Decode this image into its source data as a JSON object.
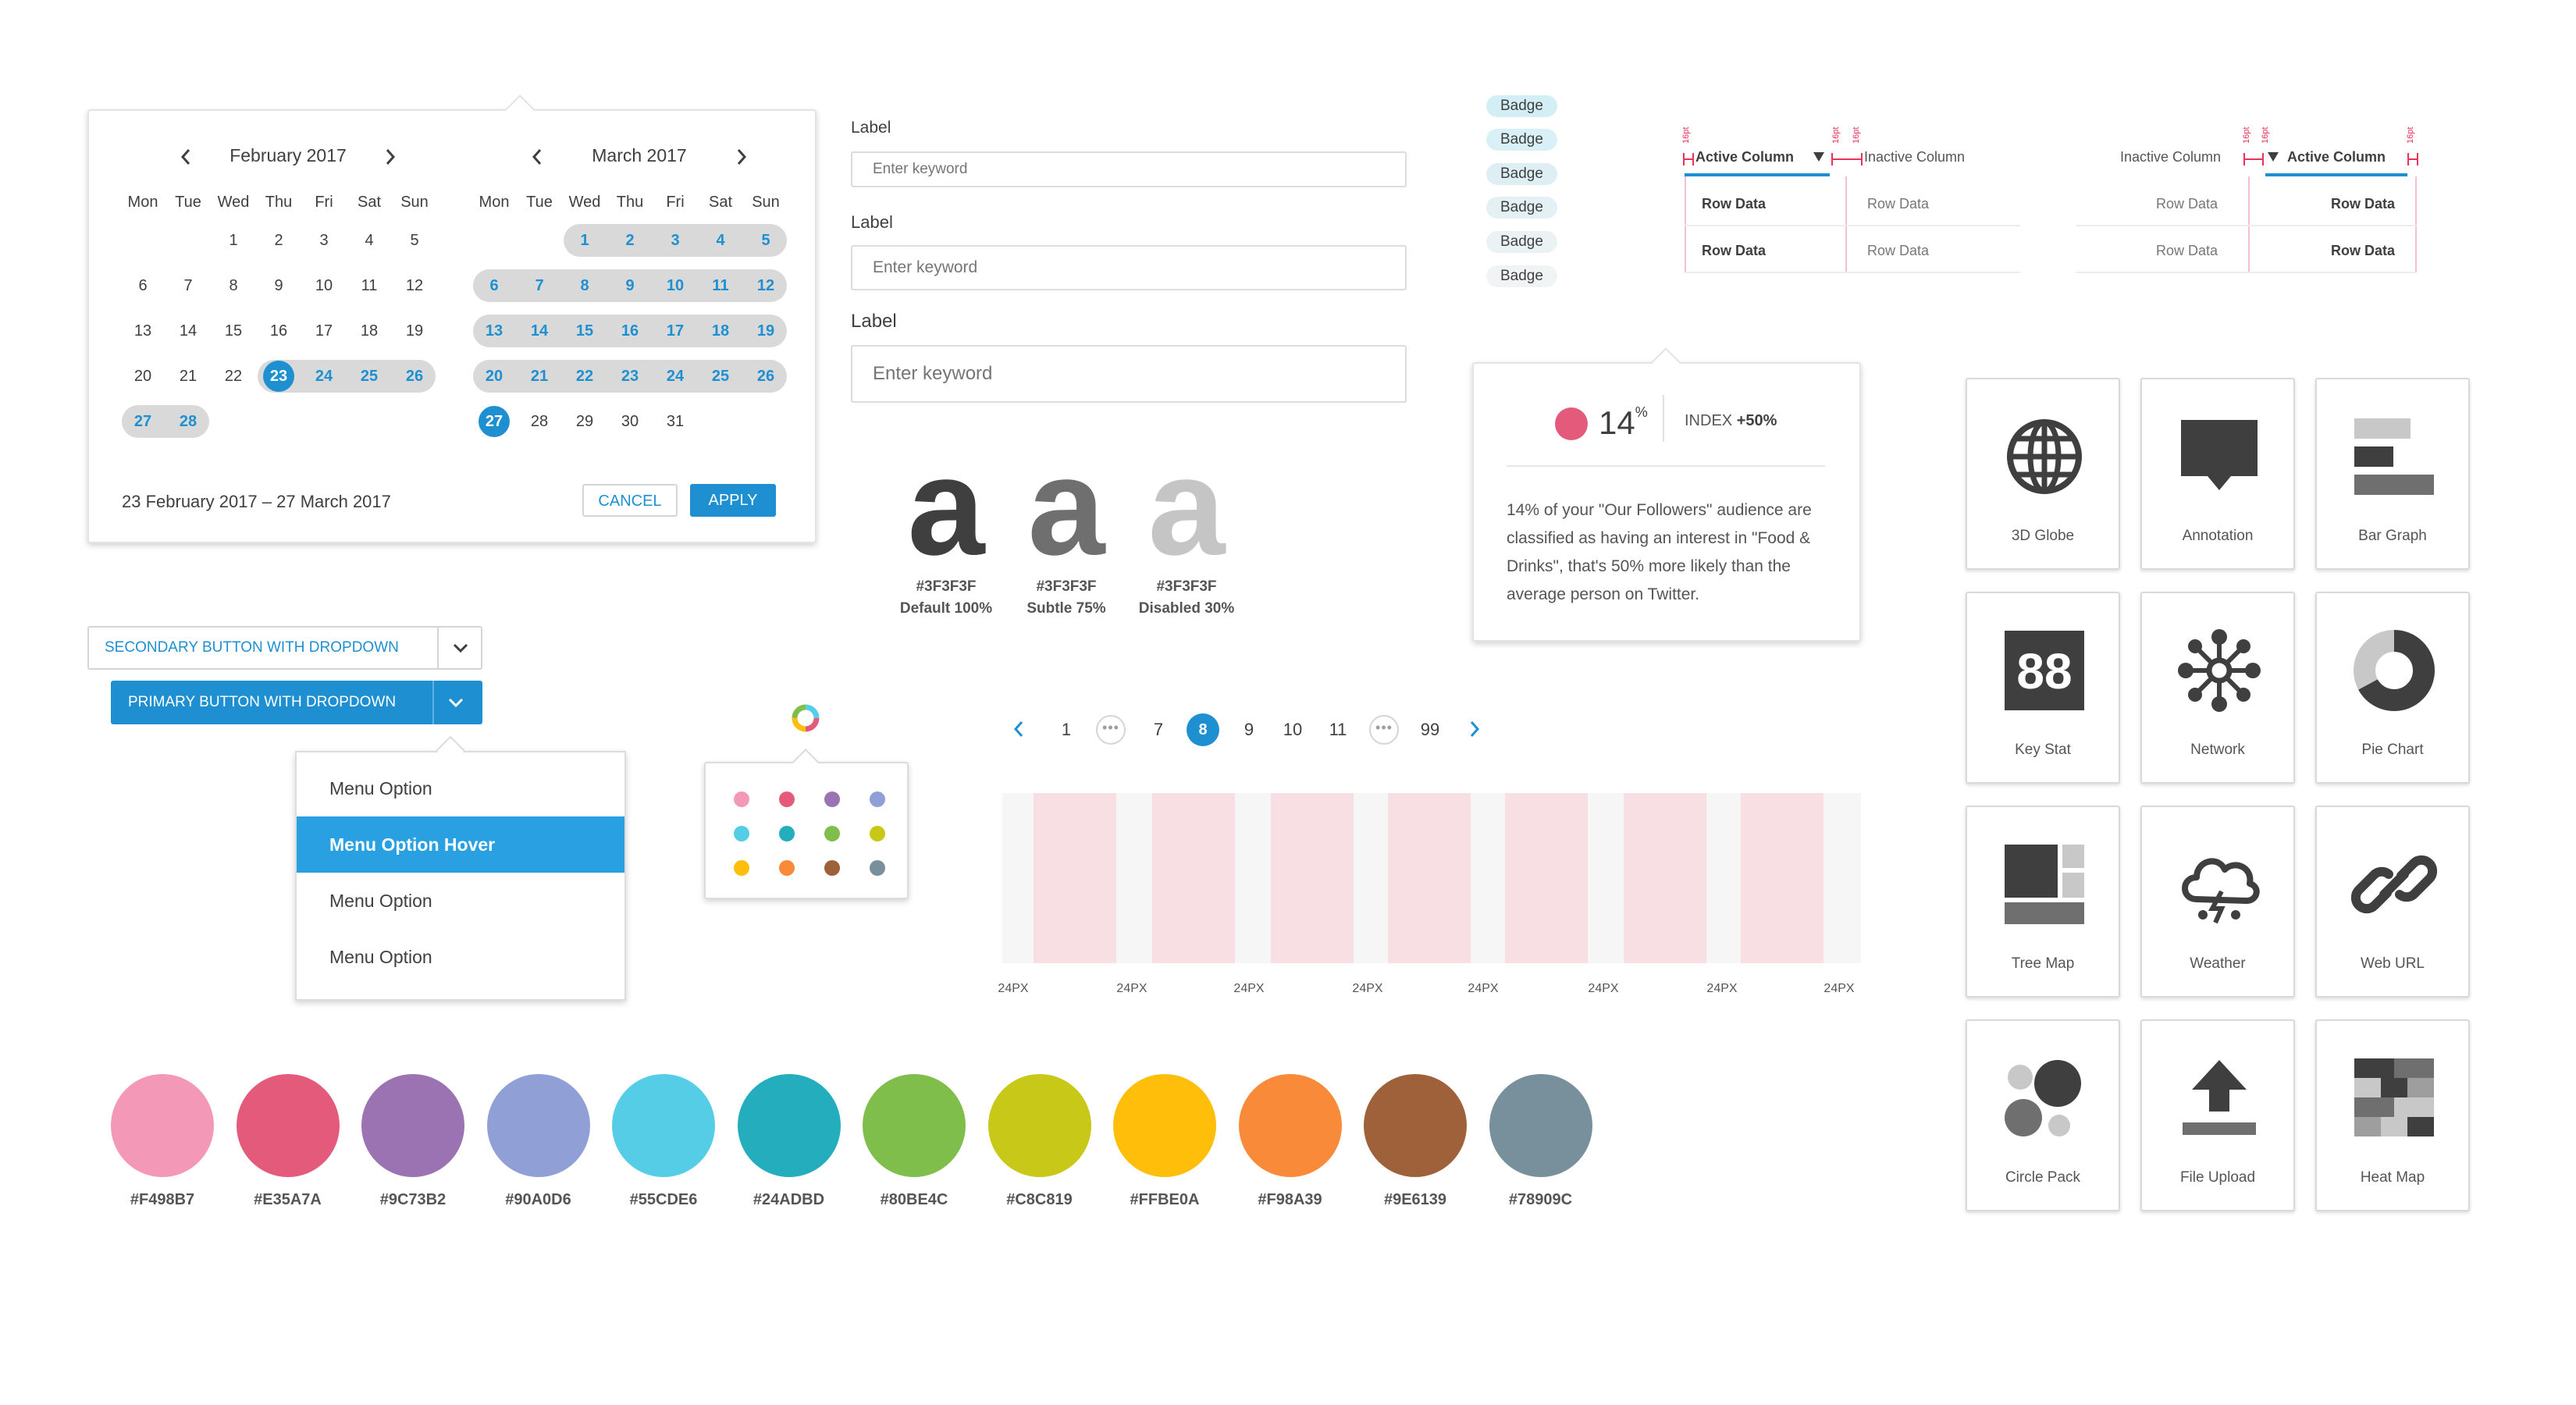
{
  "calendar": {
    "left": {
      "title": "February 2017",
      "dows": [
        "Mon",
        "Tue",
        "Wed",
        "Thu",
        "Fri",
        "Sat",
        "Sun"
      ],
      "weeks": [
        [
          "",
          "",
          "1",
          "2",
          "3",
          "4",
          "5"
        ],
        [
          "6",
          "7",
          "8",
          "9",
          "10",
          "11",
          "12"
        ],
        [
          "13",
          "14",
          "15",
          "16",
          "17",
          "18",
          "19"
        ],
        [
          "20",
          "21",
          "22",
          "23",
          "24",
          "25",
          "26"
        ],
        [
          "27",
          "28",
          "",
          "",
          "",
          "",
          ""
        ]
      ]
    },
    "right": {
      "title": "March 2017",
      "dows": [
        "Mon",
        "Tue",
        "Wed",
        "Thu",
        "Fri",
        "Sat",
        "Sun"
      ],
      "weeks": [
        [
          "",
          "",
          "1",
          "2",
          "3",
          "4",
          "5"
        ],
        [
          "6",
          "7",
          "8",
          "9",
          "10",
          "11",
          "12"
        ],
        [
          "13",
          "14",
          "15",
          "16",
          "17",
          "18",
          "19"
        ],
        [
          "20",
          "21",
          "22",
          "23",
          "24",
          "25",
          "26"
        ],
        [
          "27",
          "28",
          "29",
          "30",
          "31",
          "",
          ""
        ]
      ]
    },
    "range_text": "23 February 2017 – 27 March 2017",
    "cancel_label": "CANCEL",
    "apply_label": "APPLY"
  },
  "inputs": [
    {
      "label": "Label",
      "placeholder": "Enter keyword"
    },
    {
      "label": "Label",
      "placeholder": "Enter keyword"
    },
    {
      "label": "Label",
      "placeholder": "Enter keyword"
    }
  ],
  "typography": [
    {
      "glyph": "a",
      "hex": "#3F3F3F",
      "name": "Default 100%",
      "color": "#3f3f3f"
    },
    {
      "glyph": "a",
      "hex": "#3F3F3F",
      "name": "Subtle 75%",
      "color": "#6f6f6f"
    },
    {
      "glyph": "a",
      "hex": "#3F3F3F",
      "name": "Disabled 30%",
      "color": "#c5c5c5"
    }
  ],
  "badges": [
    "Badge",
    "Badge",
    "Badge",
    "Badge",
    "Badge",
    "Badge"
  ],
  "table1": {
    "active_header": "Active Column",
    "inactive_header": "Inactive Column",
    "rows": [
      [
        "Row Data",
        "Row Data"
      ],
      [
        "Row Data",
        "Row Data"
      ]
    ],
    "spec_label": "16pt"
  },
  "table2": {
    "inactive_header": "Inactive Column",
    "active_header": "Active Column",
    "rows": [
      [
        "Row Data",
        "Row Data"
      ],
      [
        "Row Data",
        "Row Data"
      ]
    ],
    "spec_label": "16pt"
  },
  "stat_card": {
    "value": "14",
    "unit": "%",
    "index_label": "INDEX",
    "index_value": "+50%",
    "description": "14% of your \"Our Followers\" audience are classified as having an interest in \"Food & Drinks\", that's 50% more likely than the average person on Twitter.",
    "dot_color": "#E35A7A"
  },
  "buttons": {
    "secondary_label": "SECONDARY BUTTON WITH DROPDOWN",
    "primary_label": "PRIMARY BUTTON WITH DROPDOWN"
  },
  "menu": [
    "Menu Option",
    "Menu Option Hover",
    "Menu Option",
    "Menu Option"
  ],
  "palette_dots": [
    "#F498B7",
    "#E35A7A",
    "#9C73B2",
    "#90A0D6",
    "#55CDE6",
    "#24ADBD",
    "#80BE4C",
    "#C8C819",
    "#FFBE0A",
    "#F98A39",
    "#9E6139",
    "#78909C"
  ],
  "pagination": {
    "pages": [
      "1",
      "7",
      "8",
      "9",
      "10",
      "11",
      "99"
    ],
    "current": "8",
    "ellipsis": "•••"
  },
  "grid": {
    "gutter_label": "24PX",
    "columns": 7
  },
  "colors": [
    {
      "hex": "#F498B7"
    },
    {
      "hex": "#E35A7A"
    },
    {
      "hex": "#9C73B2"
    },
    {
      "hex": "#90A0D6"
    },
    {
      "hex": "#55CDE6"
    },
    {
      "hex": "#24ADBD"
    },
    {
      "hex": "#80BE4C"
    },
    {
      "hex": "#C8C819"
    },
    {
      "hex": "#FFBE0A"
    },
    {
      "hex": "#F98A39"
    },
    {
      "hex": "#9E6139"
    },
    {
      "hex": "#78909C"
    }
  ],
  "icon_cards": [
    {
      "label": "3D Globe",
      "icon": "globe-icon"
    },
    {
      "label": "Annotation",
      "icon": "annotation-icon"
    },
    {
      "label": "Bar Graph",
      "icon": "bar-graph-icon"
    },
    {
      "label": "Key Stat",
      "icon": "key-stat-icon",
      "glyph": "88"
    },
    {
      "label": "Network",
      "icon": "network-icon"
    },
    {
      "label": "Pie Chart",
      "icon": "pie-chart-icon"
    },
    {
      "label": "Tree Map",
      "icon": "tree-map-icon"
    },
    {
      "label": "Weather",
      "icon": "weather-icon"
    },
    {
      "label": "Web URL",
      "icon": "web-url-icon"
    },
    {
      "label": "Circle Pack",
      "icon": "circle-pack-icon"
    },
    {
      "label": "File Upload",
      "icon": "file-upload-icon"
    },
    {
      "label": "Heat Map",
      "icon": "heat-map-icon"
    }
  ]
}
